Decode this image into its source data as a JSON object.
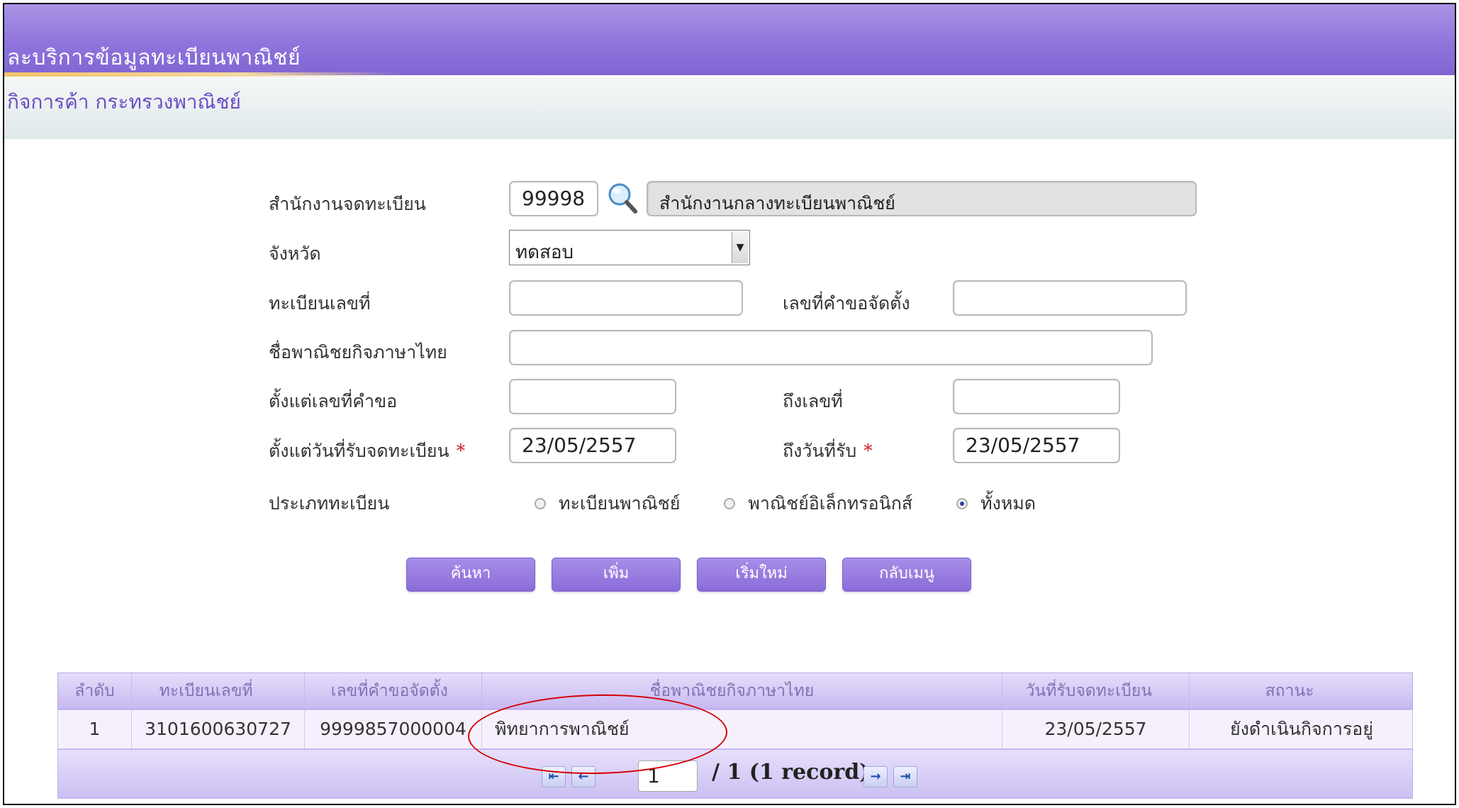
{
  "header": {
    "title": "ละบริการข้อมูลทะเบียนพาณิชย์",
    "subtitle": "กิจการค้า  กระทรวงพาณิชย์"
  },
  "form": {
    "office_label": "สำนักงานจดทะเบียน",
    "office_code": "99998",
    "office_name": "สำนักงานกลางทะเบียนพาณิชย์",
    "province_label": "จังหวัด",
    "province_value": "ทดสอบ",
    "reg_no_label": "ทะเบียนเลขที่",
    "reg_no_value": "",
    "request_no_label": "เลขที่คำขอจัดตั้ง",
    "request_no_value": "",
    "thai_name_label": "ชื่อพาณิชยกิจภาษาไทย",
    "thai_name_value": "",
    "from_request_label": "ตั้งแต่เลขที่คำขอ",
    "from_request_value": "",
    "to_no_label": "ถึงเลขที่",
    "to_no_value": "",
    "from_date_label": "ตั้งแต่วันที่รับจดทะเบียน",
    "from_date_value": "23/05/2557",
    "to_date_label": "ถึงวันที่รับ",
    "to_date_value": "23/05/2557",
    "required_mark": "*",
    "reg_type_label": "ประเภททะเบียน",
    "reg_type_options": [
      "ทะเบียนพาณิชย์",
      "พาณิชย์อิเล็กทรอนิกส์",
      "ทั้งหมด"
    ],
    "reg_type_selected": "ทั้งหมด"
  },
  "buttons": {
    "search": "ค้นหา",
    "add": "เพิ่ม",
    "reset": "เริ่มใหม่",
    "back": "กลับเมนู"
  },
  "table": {
    "columns": [
      "ลำดับ",
      "ทะเบียนเลขที่",
      "เลขที่คำขอจัดตั้ง",
      "ชื่อพาณิชยกิจภาษาไทย",
      "วันที่รับจดทะเบียน",
      "สถานะ"
    ],
    "rows": [
      [
        "1",
        "3101600630727",
        "9999857000004",
        "พิทยาการพาณิชย์",
        "23/05/2557",
        "ยังดำเนินกิจการอยู่"
      ]
    ]
  },
  "pager": {
    "page": "1",
    "summary": "/ 1  (1 record)"
  }
}
